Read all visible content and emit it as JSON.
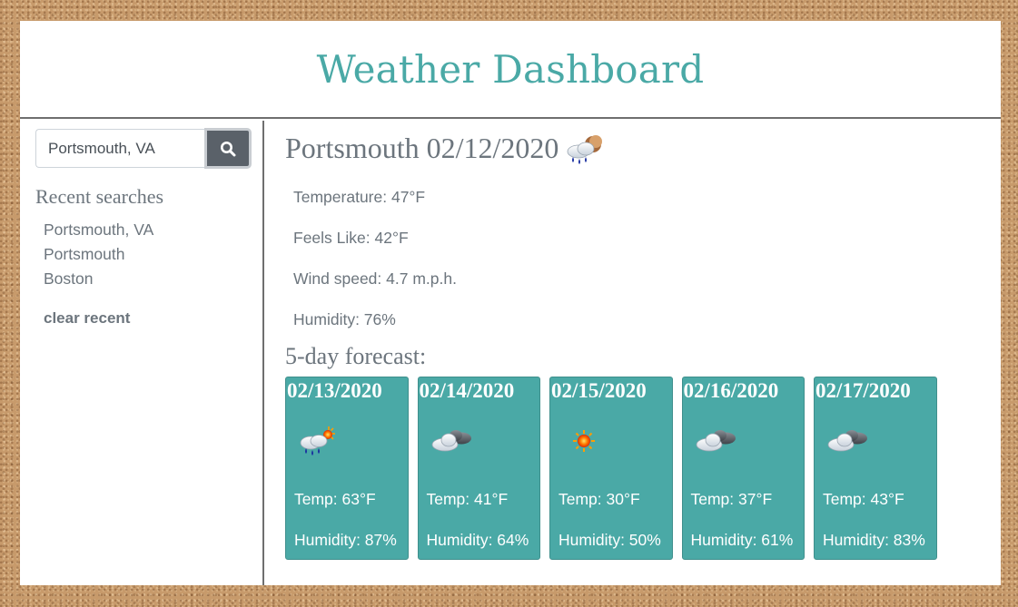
{
  "header": {
    "title": "Weather Dashboard"
  },
  "sidebar": {
    "search": {
      "value": "Portsmouth, VA",
      "button_icon": "search-icon"
    },
    "recent_heading": "Recent searches",
    "recent": [
      "Portsmouth, VA",
      "Portsmouth",
      "Boston"
    ],
    "clear_label": "clear recent"
  },
  "current": {
    "title": "Portsmouth 02/12/2020",
    "icon": "night-rain-icon",
    "temperature": "Temperature: 47°F",
    "feels_like": "Feels Like: 42°F",
    "wind": "Wind speed: 4.7 m.p.h.",
    "humidity": "Humidity: 76%"
  },
  "forecast": {
    "heading": "5-day forecast:",
    "days": [
      {
        "date": "02/13/2020",
        "icon": "sun-rain-icon",
        "temp": "Temp: 63°F",
        "humidity": "Humidity: 87%"
      },
      {
        "date": "02/14/2020",
        "icon": "broken-clouds-icon",
        "temp": "Temp: 41°F",
        "humidity": "Humidity: 64%"
      },
      {
        "date": "02/15/2020",
        "icon": "clear-sky-icon",
        "temp": "Temp: 30°F",
        "humidity": "Humidity: 50%"
      },
      {
        "date": "02/16/2020",
        "icon": "broken-clouds-icon",
        "temp": "Temp: 37°F",
        "humidity": "Humidity: 61%"
      },
      {
        "date": "02/17/2020",
        "icon": "broken-clouds-icon",
        "temp": "Temp: 43°F",
        "humidity": "Humidity: 83%"
      }
    ]
  },
  "colors": {
    "accent": "#4aa9a6",
    "text": "#6c757d",
    "button": "#5a6169",
    "board": "#c79a6b"
  }
}
